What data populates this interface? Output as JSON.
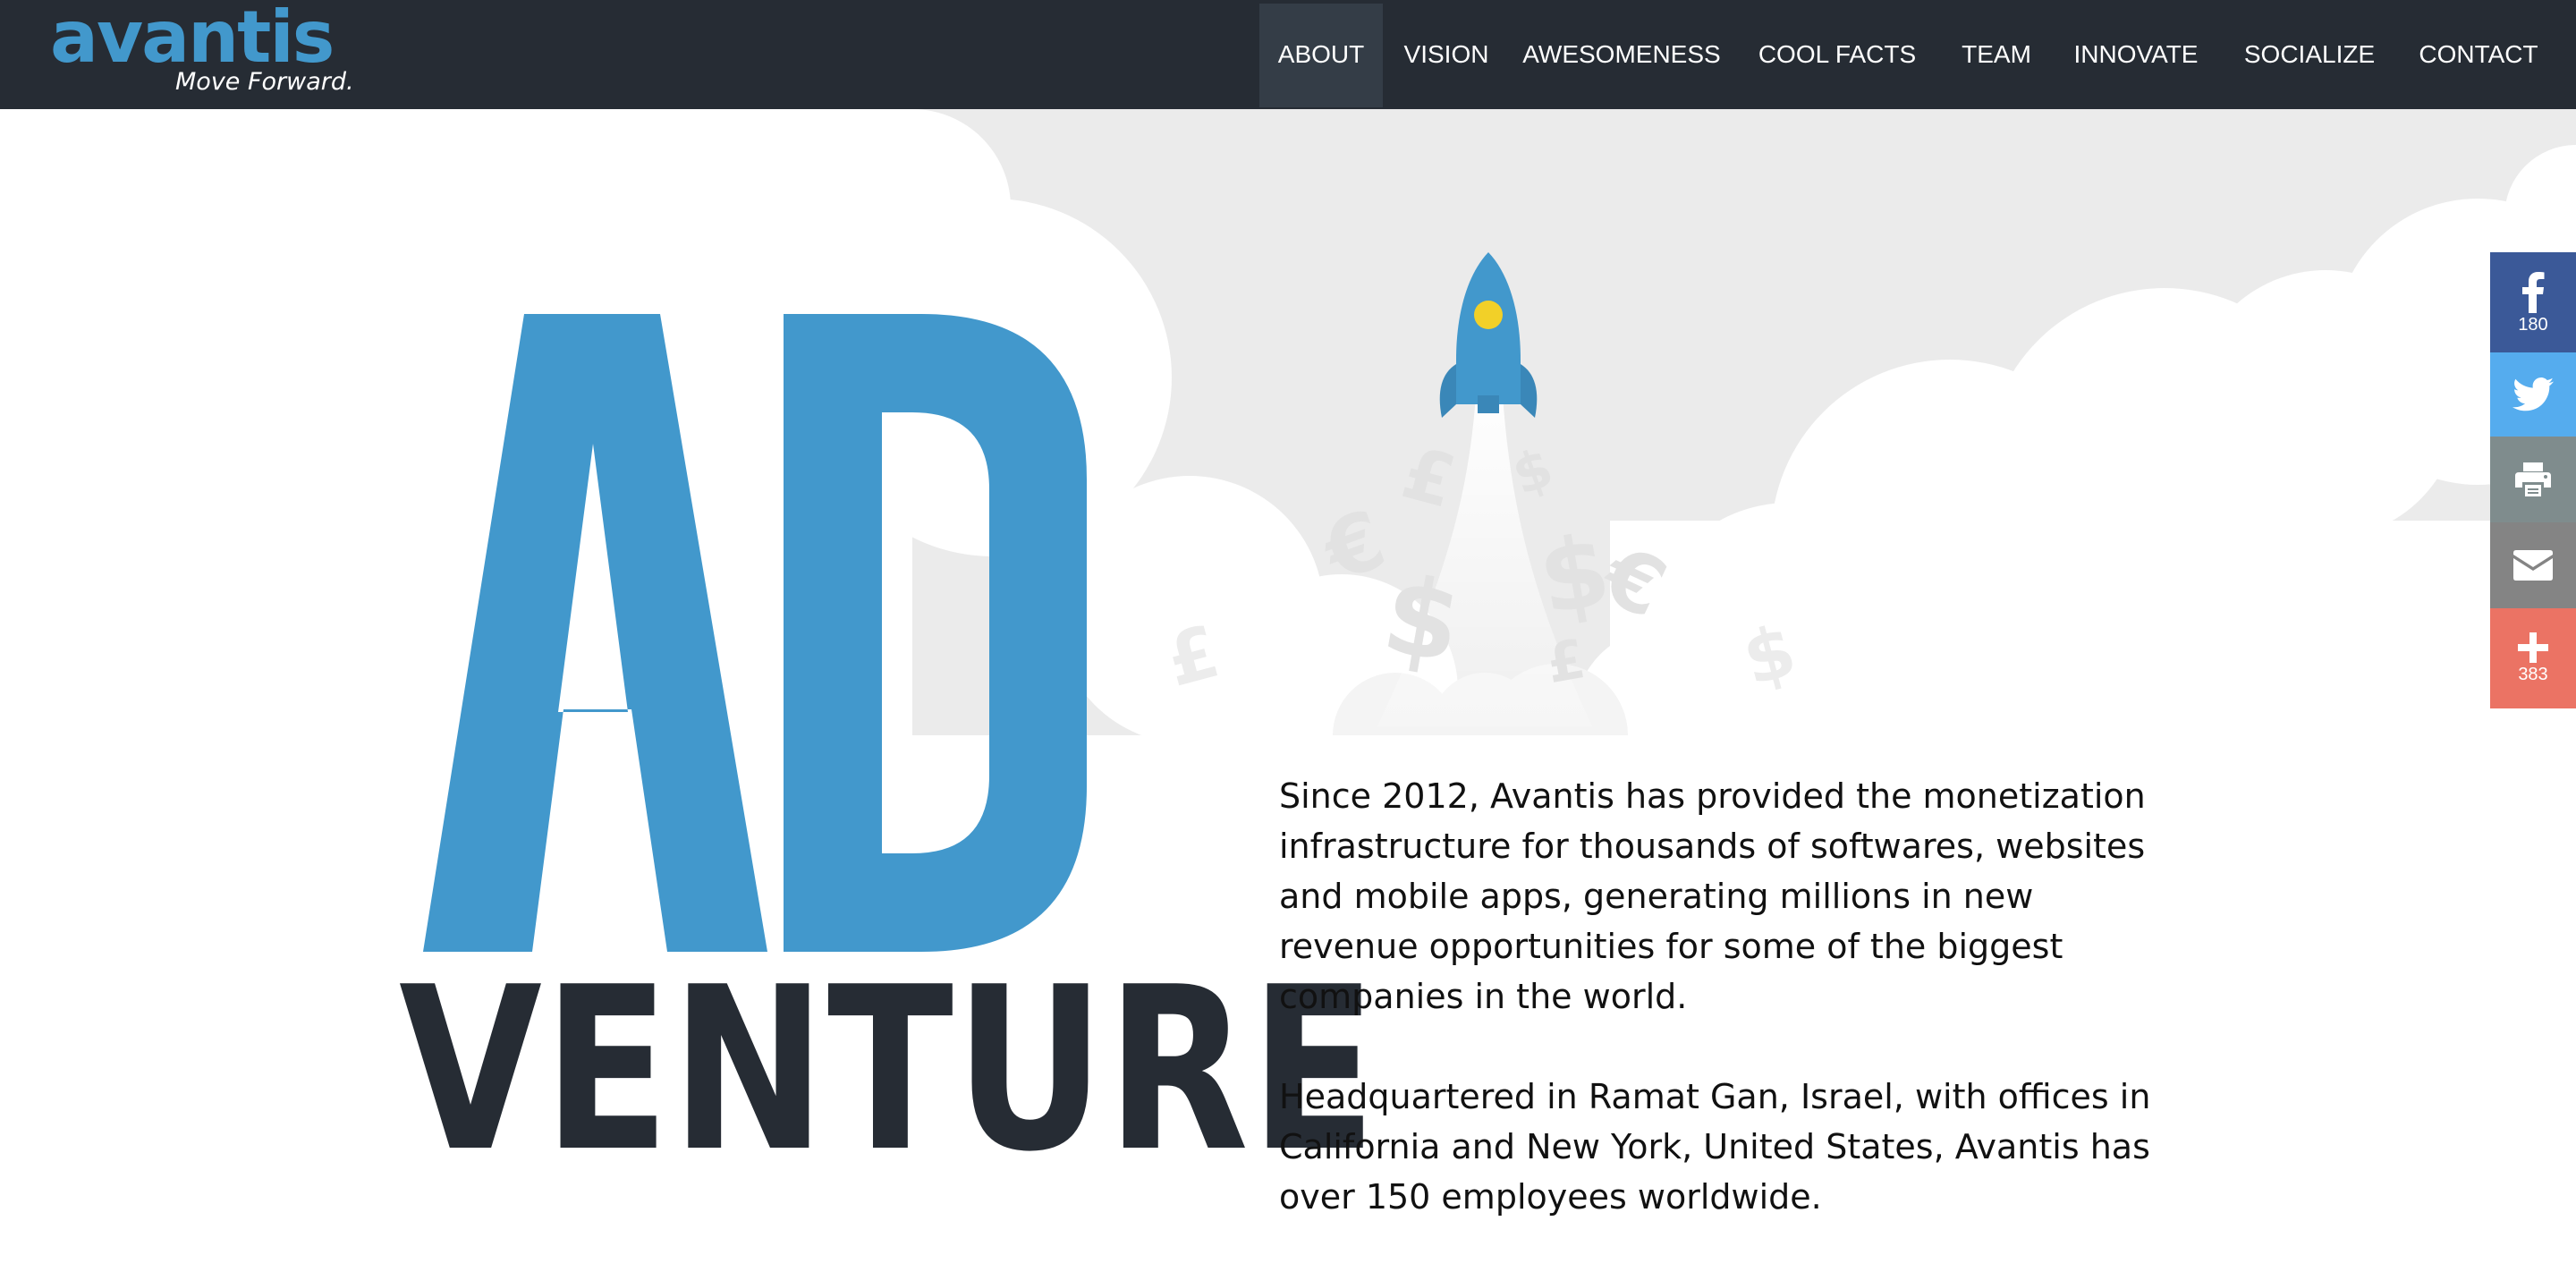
{
  "header": {
    "logo_text": "avantis",
    "logo_tagline": "Move Forward.",
    "nav": [
      {
        "label": "ABOUT",
        "active": true
      },
      {
        "label": "VISION",
        "active": false
      },
      {
        "label": "AWESOMENESS",
        "active": false
      },
      {
        "label": "COOL FACTS",
        "active": false
      },
      {
        "label": "TEAM",
        "active": false
      },
      {
        "label": "INNOVATE",
        "active": false
      },
      {
        "label": "SOCIALIZE",
        "active": false
      },
      {
        "label": "CONTACT",
        "active": false
      }
    ]
  },
  "hero": {
    "headline_top": "AD",
    "headline_bottom": "VENTURE",
    "paragraphs": [
      "Since 2012, Avantis has provided the monetization infrastructure for thousands of softwares, websites and mobile apps, generating millions in new revenue opportunities for some of the biggest companies in the world.",
      "Headquartered in Ramat Gan, Israel, with offices in California and New York, United States, Avantis has over 150 employees worldwide."
    ],
    "currency_symbols": [
      "£",
      "$",
      "€",
      "$",
      "$",
      "€",
      "£",
      "£",
      "$"
    ]
  },
  "share": {
    "facebook_count": "180",
    "more_count": "383",
    "buttons": [
      {
        "name": "facebook",
        "icon": "facebook-icon"
      },
      {
        "name": "twitter",
        "icon": "twitter-icon"
      },
      {
        "name": "print",
        "icon": "print-icon"
      },
      {
        "name": "email",
        "icon": "email-icon"
      },
      {
        "name": "more",
        "icon": "plus-icon"
      }
    ]
  },
  "colors": {
    "header_bg": "#262c34",
    "nav_active_bg": "#343d47",
    "brand_blue": "#4298cc",
    "headline_dark": "#262c34",
    "cloud_gray": "#ebebeb",
    "facebook": "#3b5998",
    "twitter": "#55acee",
    "print": "#7f8c8d",
    "email": "#848484",
    "more": "#eb7364"
  }
}
